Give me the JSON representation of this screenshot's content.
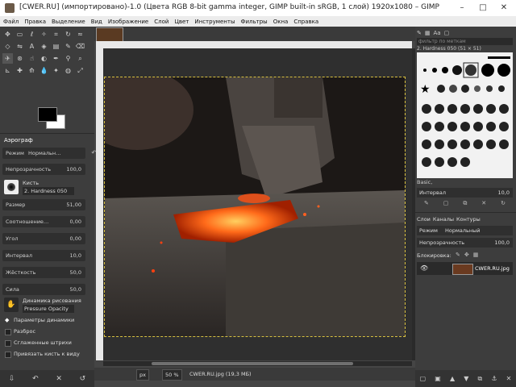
{
  "window": {
    "title": "[CWER.RU] (импортировано)-1.0 (Цвета RGB 8-bit gamma integer, GIMP built-in sRGB, 1 слой) 1920x1080 – GIMP"
  },
  "menu": [
    "Файл",
    "Правка",
    "Выделение",
    "Вид",
    "Изображение",
    "Слой",
    "Цвет",
    "Инструменты",
    "Фильтры",
    "Окна",
    "Справка"
  ],
  "tool_options": {
    "header": "Аэрограф",
    "mode_label": "Режим",
    "mode_value": "Нормальн…",
    "opacity": {
      "label": "Непрозрачность",
      "value": "100,0"
    },
    "brush": {
      "label": "Кисть",
      "value": "2. Hardness 050"
    },
    "params": [
      {
        "label": "Размер",
        "value": "51,00"
      },
      {
        "label": "Соотношение…",
        "value": "0,00"
      },
      {
        "label": "Угол",
        "value": "0,00"
      },
      {
        "label": "Интервал",
        "value": "10,0"
      },
      {
        "label": "Жёсткость",
        "value": "50,0"
      },
      {
        "label": "Сила",
        "value": "50,0"
      }
    ],
    "dynamics": {
      "label": "Динамика рисования",
      "value": "Pressure Opacity"
    },
    "checks": [
      "Параметры динамики",
      "Разброс",
      "Сглаженные штрихи",
      "Привязать кисть к виду"
    ]
  },
  "status": {
    "unit": "px",
    "zoom": "50 %",
    "file": "CWER.RU.jpg (19,3 МБ)"
  },
  "dock": {
    "filter_placeholder": "фильтр по меткам",
    "brush_name": "2. Hardness 050 (51 × 51)",
    "preset": "Basic,",
    "spacing": {
      "label": "Интервал",
      "value": "10,0"
    },
    "tabs": [
      "Слои",
      "Каналы",
      "Контуры"
    ],
    "mode_label": "Режим",
    "mode_value": "Нормальный",
    "opacity": {
      "label": "Непрозрачность",
      "value": "100,0"
    },
    "lock_label": "Блокировка:",
    "layer_name": "CWER.RU.jpg"
  },
  "colors": {
    "fg": "#000000",
    "bg": "#ffffff",
    "accent": "#f08030"
  }
}
